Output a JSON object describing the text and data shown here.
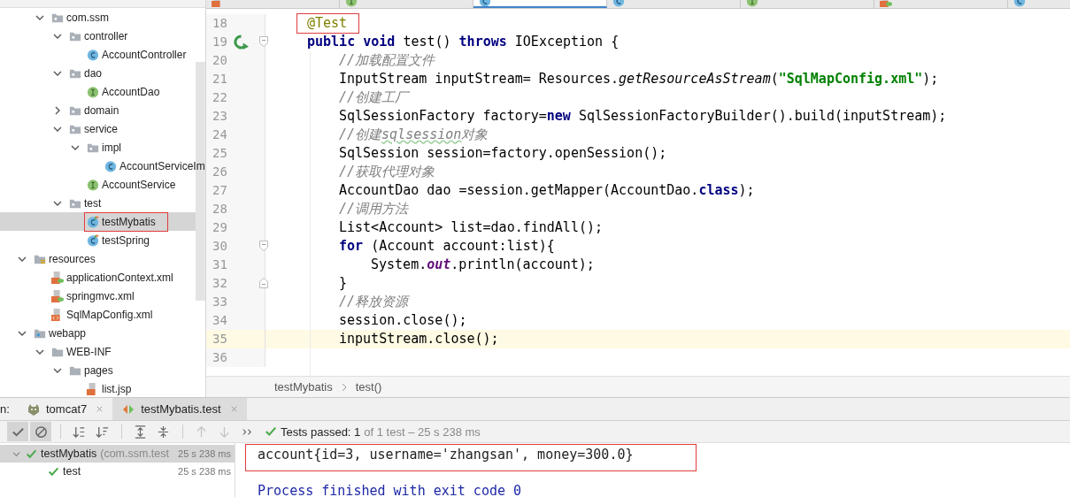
{
  "editor_tabs": [
    {
      "kind": "jsp",
      "selected": false
    },
    {
      "kind": "interface",
      "selected": false
    },
    {
      "kind": "class",
      "selected": true
    },
    {
      "kind": "class",
      "selected": false
    },
    {
      "kind": "interface",
      "selected": false
    },
    {
      "kind": "xml-spring",
      "selected": false
    },
    {
      "kind": "class",
      "selected": false
    }
  ],
  "project": {
    "continued_children": [
      {
        "name": "com.ssm",
        "kind": "package",
        "expanded": true,
        "selected": false,
        "boxed": false,
        "children": [
          {
            "name": "controller",
            "kind": "package",
            "expanded": true,
            "selected": false,
            "boxed": false,
            "children": [
              {
                "name": "AccountController",
                "kind": "class",
                "selected": false,
                "boxed": false
              }
            ]
          },
          {
            "name": "dao",
            "kind": "package",
            "expanded": true,
            "selected": false,
            "boxed": false,
            "children": [
              {
                "name": "AccountDao",
                "kind": "interface",
                "selected": false,
                "boxed": false
              }
            ]
          },
          {
            "name": "domain",
            "kind": "package",
            "expanded": false,
            "selected": false,
            "boxed": false
          },
          {
            "name": "service",
            "kind": "package",
            "expanded": true,
            "selected": false,
            "boxed": false,
            "children": [
              {
                "name": "impl",
                "kind": "package",
                "expanded": true,
                "selected": false,
                "boxed": false,
                "children": [
                  {
                    "name": "AccountServiceIm",
                    "kind": "class",
                    "selected": false,
                    "boxed": false
                  }
                ]
              },
              {
                "name": "AccountService",
                "kind": "interface",
                "selected": false,
                "boxed": false
              }
            ]
          },
          {
            "name": "test",
            "kind": "package",
            "expanded": true,
            "selected": false,
            "boxed": false,
            "children": [
              {
                "name": "testMybatis",
                "kind": "test-class",
                "selected": true,
                "boxed": true
              },
              {
                "name": "testSpring",
                "kind": "test-class",
                "selected": false,
                "boxed": false
              }
            ]
          }
        ]
      }
    ],
    "items": [
      {
        "name": "resources",
        "kind": "resources",
        "expanded": true,
        "selected": false,
        "boxed": false,
        "children": [
          {
            "name": "applicationContext.xml",
            "kind": "xml-spring",
            "selected": false,
            "boxed": false
          },
          {
            "name": "springmvc.xml",
            "kind": "xml-spring",
            "selected": false,
            "boxed": false
          },
          {
            "name": "SqlMapConfig.xml",
            "kind": "xml",
            "selected": false,
            "boxed": false
          }
        ]
      },
      {
        "name": "webapp",
        "kind": "webapp",
        "expanded": true,
        "selected": false,
        "boxed": false,
        "children": [
          {
            "name": "WEB-INF",
            "kind": "folder",
            "expanded": true,
            "selected": false,
            "boxed": false,
            "children": [
              {
                "name": "pages",
                "kind": "folder",
                "expanded": true,
                "selected": false,
                "boxed": false,
                "children": [
                  {
                    "name": "list.jsp",
                    "kind": "jsp",
                    "selected": false,
                    "boxed": false
                  }
                ]
              }
            ]
          }
        ]
      }
    ]
  },
  "code_lines": [
    {
      "number": "18",
      "kind": "plain",
      "current": false,
      "boxed": true,
      "tokens": [
        {
          "kind": "annotation",
          "text": "@Test"
        }
      ]
    },
    {
      "number": "19",
      "kind": "test-method",
      "current": false,
      "boxed": false,
      "tokens": [
        {
          "kind": "keyword",
          "text": "public"
        },
        {
          "kind": "keyword",
          "text": "void"
        },
        {
          "kind": "plain",
          "text": "test()"
        },
        {
          "kind": "keyword",
          "text": "throws"
        },
        {
          "kind": "plain",
          "text": "IOException {"
        }
      ],
      "children": [
        {
          "number": "20",
          "kind": "plain",
          "current": false,
          "boxed": false,
          "tokens": [
            {
              "kind": "comment",
              "text": "//加载配置文件"
            }
          ]
        },
        {
          "number": "21",
          "kind": "plain",
          "current": false,
          "boxed": false,
          "tokens": [
            {
              "kind": "plain",
              "text": "InputStream inputStream= Resources."
            },
            {
              "kind": "static-method",
              "text": "getResourceAsStream"
            },
            {
              "kind": "plain",
              "text": "("
            },
            {
              "kind": "string",
              "text": "\"SqlMapConfig.xml\""
            },
            {
              "kind": "plain",
              "text": ");"
            }
          ]
        },
        {
          "number": "22",
          "kind": "plain",
          "current": false,
          "boxed": false,
          "tokens": [
            {
              "kind": "comment",
              "text": "//创建工厂"
            }
          ]
        },
        {
          "number": "23",
          "kind": "plain",
          "current": false,
          "boxed": false,
          "tokens": [
            {
              "kind": "plain",
              "text": "SqlSessionFactory factory="
            },
            {
              "kind": "keyword",
              "text": "new"
            },
            {
              "kind": "plain",
              "text": "SqlSessionFactoryBuilder().build(inputStream);"
            }
          ]
        },
        {
          "number": "24",
          "kind": "plain",
          "current": false,
          "boxed": false,
          "tokens": [
            {
              "kind": "comment",
              "text": "//创建"
            },
            {
              "kind": "comment-typo",
              "text": "sqlsession"
            },
            {
              "kind": "comment",
              "text": "对象"
            }
          ]
        },
        {
          "number": "25",
          "kind": "plain",
          "current": false,
          "boxed": false,
          "tokens": [
            {
              "kind": "plain",
              "text": "SqlSession session=factory.openSession();"
            }
          ]
        },
        {
          "number": "26",
          "kind": "plain",
          "current": false,
          "boxed": false,
          "tokens": [
            {
              "kind": "comment",
              "text": "//获取代理对象"
            }
          ]
        },
        {
          "number": "27",
          "kind": "plain",
          "current": false,
          "boxed": false,
          "tokens": [
            {
              "kind": "plain",
              "text": "AccountDao dao =session.getMapper(AccountDao."
            },
            {
              "kind": "keyword",
              "text": "class"
            },
            {
              "kind": "plain",
              "text": ");"
            }
          ]
        },
        {
          "number": "28",
          "kind": "plain",
          "current": false,
          "boxed": false,
          "tokens": [
            {
              "kind": "comment",
              "text": "//调用方法"
            }
          ]
        },
        {
          "number": "29",
          "kind": "plain",
          "current": false,
          "boxed": false,
          "tokens": [
            {
              "kind": "plain",
              "text": "List<Account> list=dao.findAll();"
            }
          ]
        },
        {
          "number": "30",
          "kind": "block-start",
          "current": false,
          "boxed": false,
          "tokens": [
            {
              "kind": "keyword",
              "text": "for"
            },
            {
              "kind": "plain",
              "text": "(Account account:list){"
            }
          ],
          "children": [
            {
              "number": "31",
              "kind": "plain",
              "current": false,
              "boxed": false,
              "tokens": [
                {
                  "kind": "plain",
                  "text": "System."
                },
                {
                  "kind": "static-field",
                  "text": "out"
                },
                {
                  "kind": "plain",
                  "text": ".println(account);"
                }
              ]
            }
          ]
        },
        {
          "number": "32",
          "kind": "block-end",
          "current": false,
          "boxed": false,
          "tokens": [
            {
              "kind": "plain",
              "text": "}"
            }
          ]
        },
        {
          "number": "33",
          "kind": "plain",
          "current": false,
          "boxed": false,
          "tokens": [
            {
              "kind": "comment",
              "text": "//释放资源"
            }
          ]
        },
        {
          "number": "34",
          "kind": "plain",
          "current": false,
          "boxed": false,
          "tokens": [
            {
              "kind": "plain",
              "text": "session.close();"
            }
          ]
        },
        {
          "number": "35",
          "kind": "plain",
          "current": true,
          "boxed": false,
          "tokens": [
            {
              "kind": "plain",
              "text": "inputStream.close();"
            }
          ]
        }
      ]
    },
    {
      "number": "36",
      "kind": "plain",
      "current": false,
      "boxed": false
    }
  ],
  "breadcrumb": [
    "testMybatis",
    "test()"
  ],
  "run_panel": {
    "label": "n:",
    "tabs": [
      {
        "label": "tomcat7",
        "kind": "tomcat",
        "selected": false
      },
      {
        "label": "testMybatis.test",
        "kind": "test",
        "selected": true
      }
    ],
    "toolbar": [
      {
        "kind": "check",
        "on": true,
        "disabled": false
      },
      {
        "kind": "ignore",
        "on": true,
        "disabled": false
      },
      {
        "kind": "sort-alpha",
        "on": false,
        "disabled": false
      },
      {
        "kind": "sort-duration",
        "on": false,
        "disabled": false
      },
      {
        "kind": "expand",
        "on": false,
        "disabled": false
      },
      {
        "kind": "collapse",
        "on": false,
        "disabled": false
      },
      {
        "kind": "up",
        "on": false,
        "disabled": true
      },
      {
        "kind": "down",
        "on": false,
        "disabled": true
      },
      {
        "kind": "more",
        "on": false,
        "disabled": false
      }
    ],
    "status": "Tests passed: 1",
    "status_detail": "of 1 test – 25 s 238 ms",
    "results": [
      {
        "name": "testMybatis",
        "detail": "(com.ssm.test",
        "time": "25 s 238 ms",
        "passed": true,
        "selected": true,
        "children": [
          {
            "name": "test",
            "time": "25 s 238 ms",
            "passed": true,
            "selected": false
          }
        ]
      }
    ],
    "console": [
      {
        "text": "account{id=3, username='zhangsan', money=300.0}",
        "kind": "output",
        "boxed": true
      },
      {
        "text": "Process finished with exit code 0",
        "kind": "system",
        "boxed": false
      }
    ]
  }
}
